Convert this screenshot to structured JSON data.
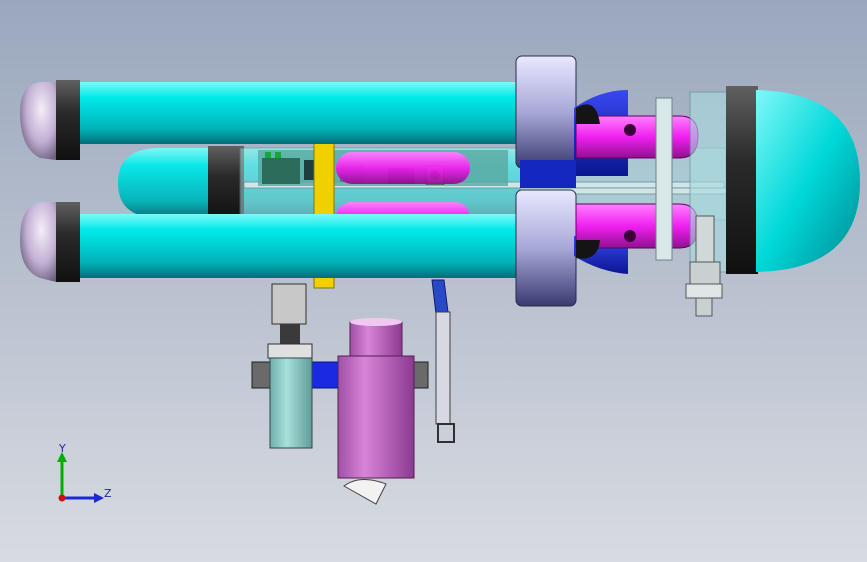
{
  "view": {
    "background_top": "#9aa7bd",
    "background_bottom": "#d8dbe1"
  },
  "model": {
    "colors": {
      "cylinder": "#00e0e0",
      "end_cap": "#c8b6d8",
      "ring": "#2a2a2a",
      "flange": "#b8b8e0",
      "bracket": "#ff20ff",
      "blue_body": "#1f2fd0",
      "sensor_body": "#c86ac8",
      "teal_body": "#8fcfc8",
      "clamp": "#f0d000",
      "frame": "#d8e8e8"
    }
  },
  "triad": {
    "y_label": "Y",
    "z_label": "Z",
    "y_color": "#00b000",
    "z_color": "#1a2ad0",
    "origin_color": "#d01010"
  }
}
